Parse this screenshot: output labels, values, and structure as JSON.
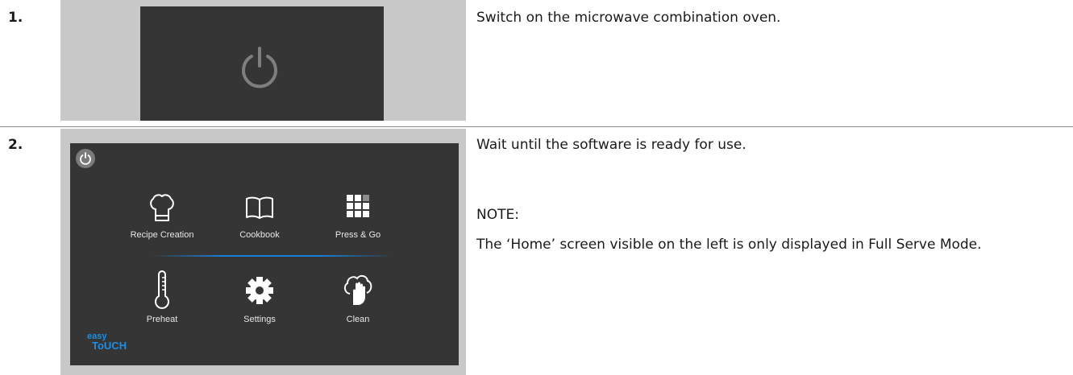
{
  "steps": [
    {
      "number": "1.",
      "description": "Switch on the microwave combination oven.",
      "screen": {
        "icon": "power-icon"
      }
    },
    {
      "number": "2.",
      "description": "Wait until the software is ready for use.",
      "note_label": "NOTE:",
      "note_text": "The ‘Home’ screen visible on the left is only displayed in Full Serve Mode.",
      "screen": {
        "power_icon": "power-icon",
        "tiles": [
          {
            "label": "Recipe Creation",
            "icon": "chef-hat-icon"
          },
          {
            "label": "Cookbook",
            "icon": "open-book-icon"
          },
          {
            "label": "Press & Go",
            "icon": "grid-icon"
          },
          {
            "label": "Preheat",
            "icon": "thermometer-icon"
          },
          {
            "label": "Settings",
            "icon": "gear-icon"
          },
          {
            "label": "Clean",
            "icon": "clean-hand-icon"
          }
        ],
        "brand": {
          "line1": "easy",
          "line2": "ToUCH"
        }
      }
    }
  ],
  "colors": {
    "screen_bg": "#353535",
    "panel_bg": "#c8c8c8",
    "accent_blue": "#1a7fd6",
    "icon_white": "#ffffff"
  }
}
